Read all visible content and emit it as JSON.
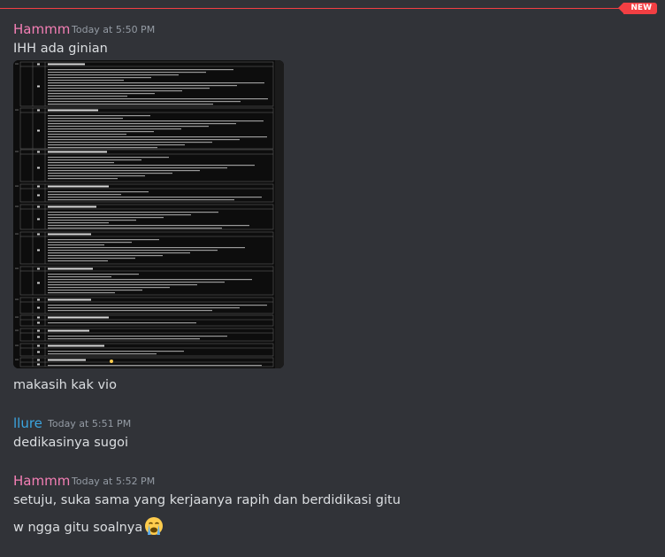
{
  "divider": {
    "badge": "NEW",
    "color": "#f23f43"
  },
  "messages": [
    {
      "author": "Hammm",
      "author_color": "#f47fb5",
      "timestamp": "Today at 5:50 PM",
      "lines": [
        "IHH ada ginian"
      ],
      "attachment": {
        "type": "image",
        "description_icon": "spreadsheet-screenshot"
      },
      "after_lines": [
        "makasih kak vio"
      ]
    },
    {
      "author": "llure",
      "author_color": "#3ba5e0",
      "timestamp": "Today at 5:51 PM",
      "lines": [
        "dedikasinya sugoi"
      ]
    },
    {
      "author": "Hammm",
      "author_color": "#f47fb5",
      "timestamp": "Today at 5:52 PM",
      "lines": [
        "setuju, suka sama yang kerjaanya rapih dan berdidikasi gitu",
        "w ngga gitu soalnya"
      ],
      "emoji": "loudly-crying-face"
    }
  ]
}
